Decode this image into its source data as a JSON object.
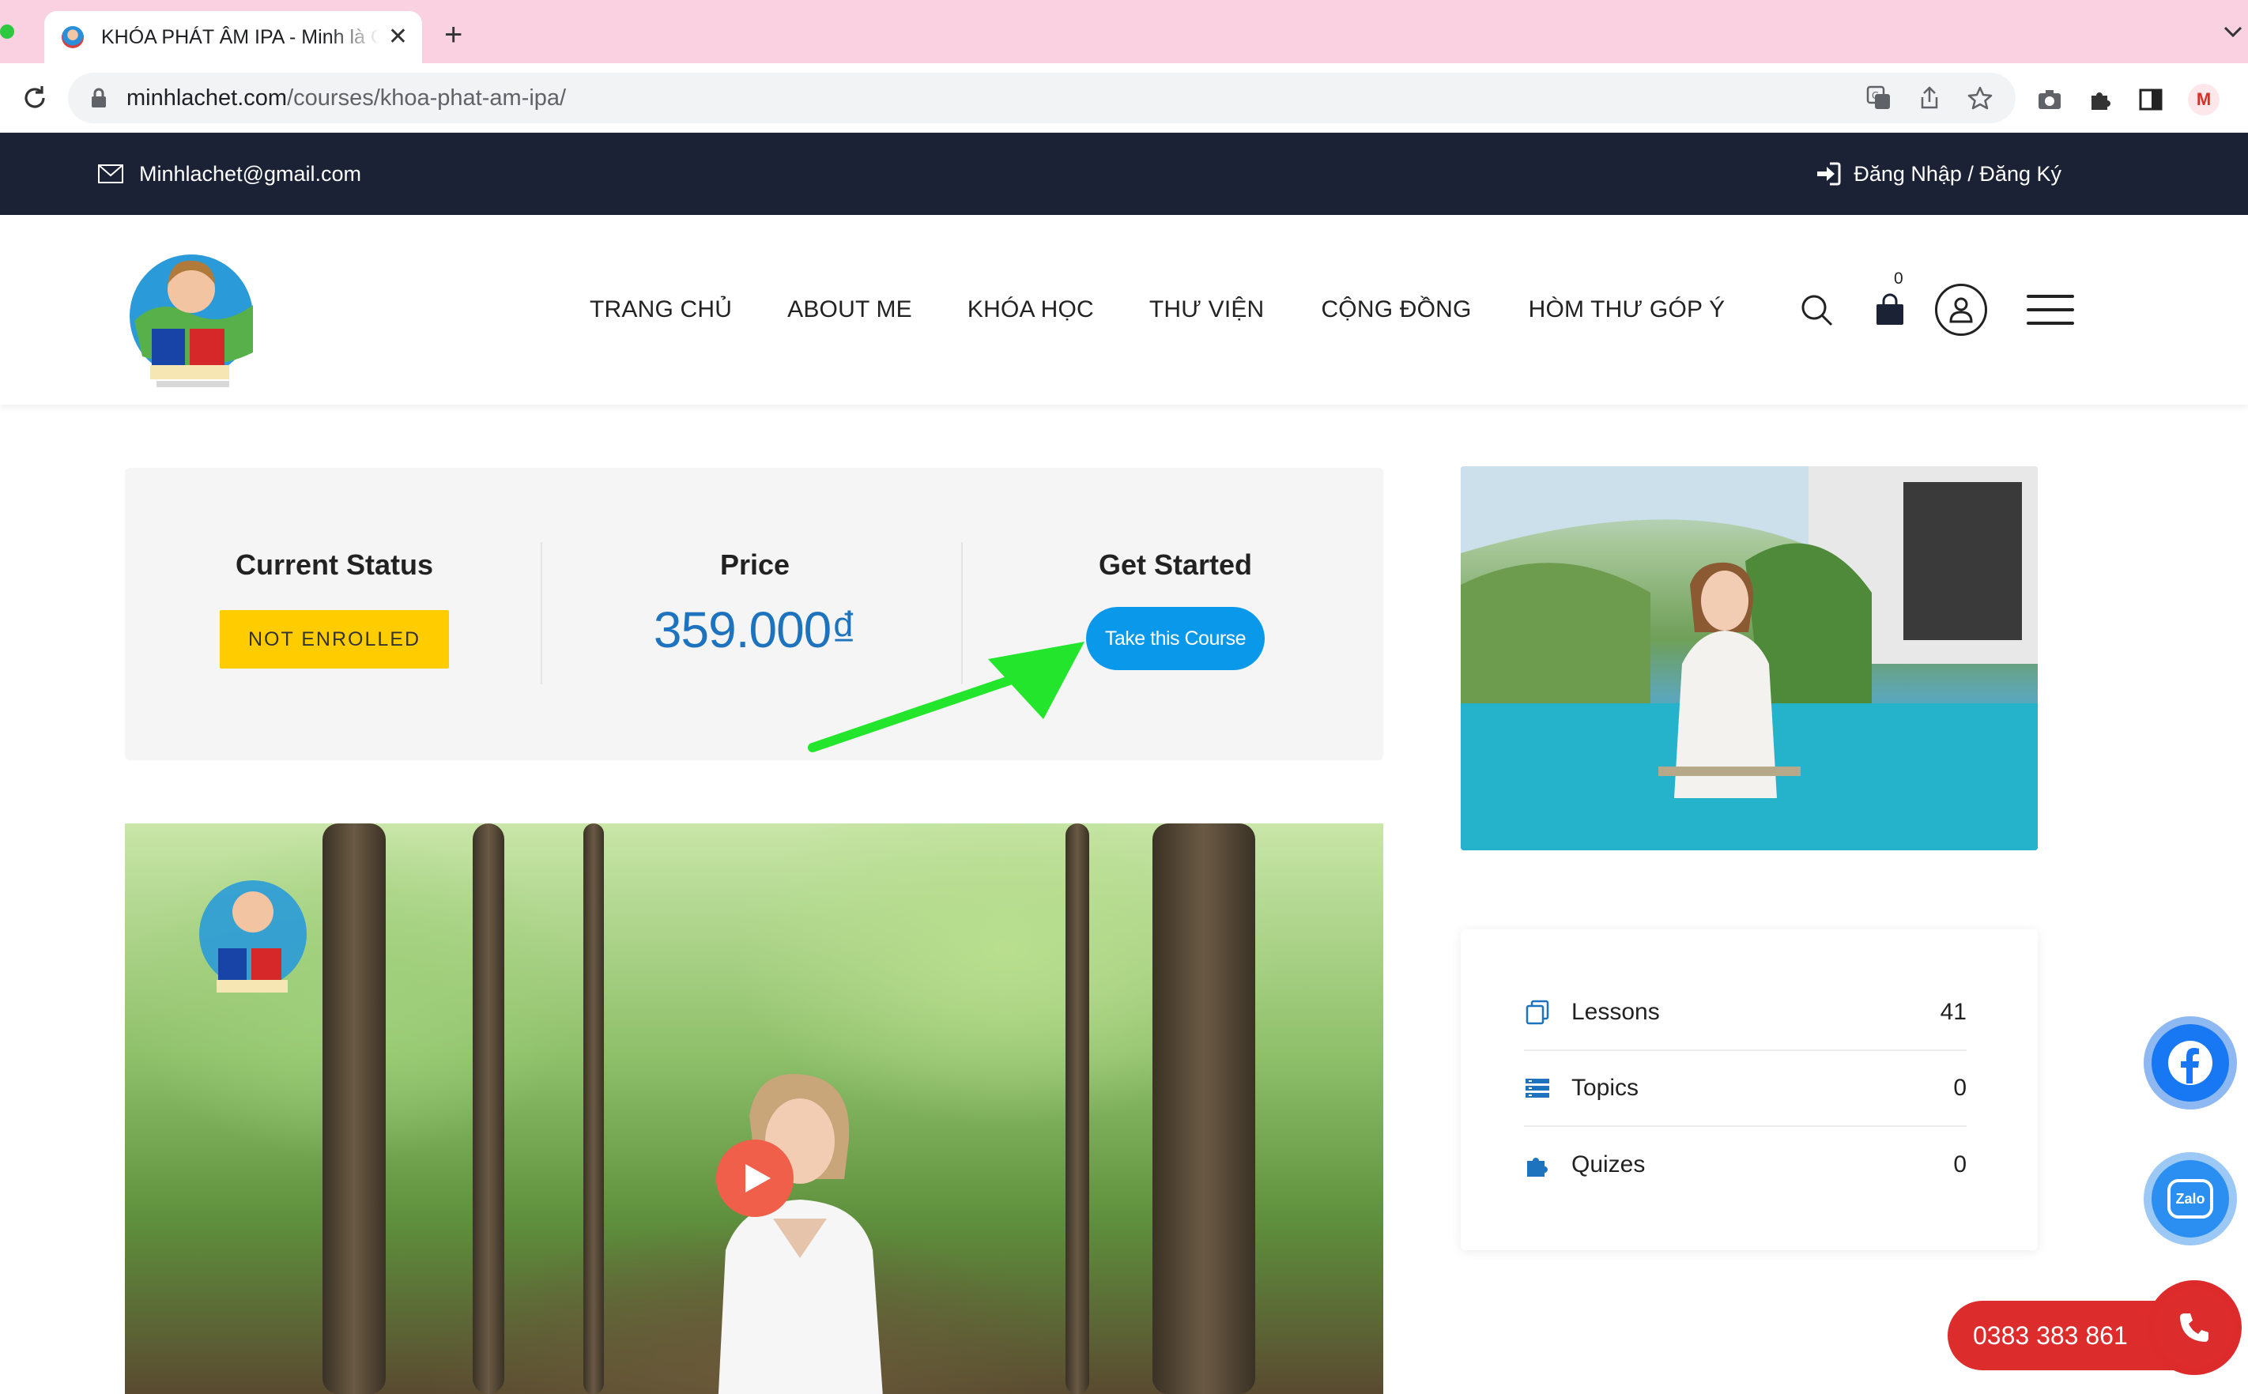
{
  "browser": {
    "tab_title": "KHÓA PHÁT ÂM IPA - Minh là Chết",
    "url_host": "minhlachet.com",
    "url_path": "/courses/khoa-phat-am-ipa/",
    "new_tab_symbol": "+",
    "tab_close_symbol": "✕",
    "profile_initial": "M"
  },
  "topbar": {
    "email": "Minhlachet@gmail.com",
    "login": "Đăng Nhập / Đăng Ký"
  },
  "nav": {
    "items": [
      "TRANG CHỦ",
      "ABOUT ME",
      "KHÓA HỌC",
      "THƯ VIỆN",
      "CỘNG ĐỒNG",
      "HÒM THƯ GÓP Ý"
    ],
    "cart_count": "0"
  },
  "course_status": {
    "status_heading": "Current Status",
    "status_value": "NOT ENROLLED",
    "price_heading": "Price",
    "price_value": "359.000₫",
    "start_heading": "Get Started",
    "start_button": "Take this Course"
  },
  "course_info": {
    "rows": [
      {
        "label": "Lessons",
        "value": "41",
        "icon": "lessons-icon"
      },
      {
        "label": "Topics",
        "value": "0",
        "icon": "topics-icon"
      },
      {
        "label": "Quizes",
        "value": "0",
        "icon": "quizes-icon"
      }
    ]
  },
  "contact": {
    "phone": "0383 383 861",
    "zalo_label": "Zalo"
  },
  "colors": {
    "tabbar": "#f9d1e1",
    "topbar": "#1c2236",
    "price": "#1e73be",
    "button": "#0a99ea",
    "badge": "#ffcc00",
    "arrow": "#22e52c",
    "phone": "#dd2c2c"
  }
}
